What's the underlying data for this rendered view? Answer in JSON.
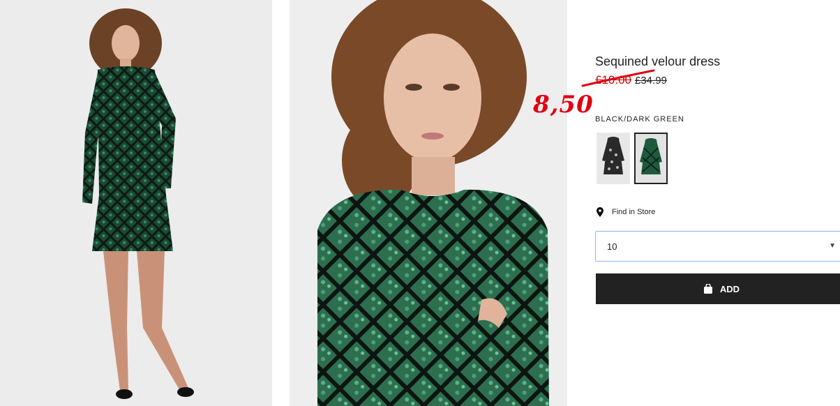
{
  "product": {
    "title": "Sequined velour dress",
    "sale_price": "£10.00",
    "original_price": "£34.99",
    "handwritten_price": "8,50",
    "color_name": "BLACK/DARK GREEN",
    "swatches": [
      {
        "name": "black-silver",
        "selected": false
      },
      {
        "name": "black-dark-green",
        "selected": true
      }
    ],
    "find_in_store": "Find in Store",
    "size_value": "10",
    "add_label": "ADD"
  },
  "colors": {
    "sale_red": "#d40000",
    "annotation_red": "#e00010",
    "button_black": "#222222",
    "dress_green": "#1e5a3c"
  }
}
